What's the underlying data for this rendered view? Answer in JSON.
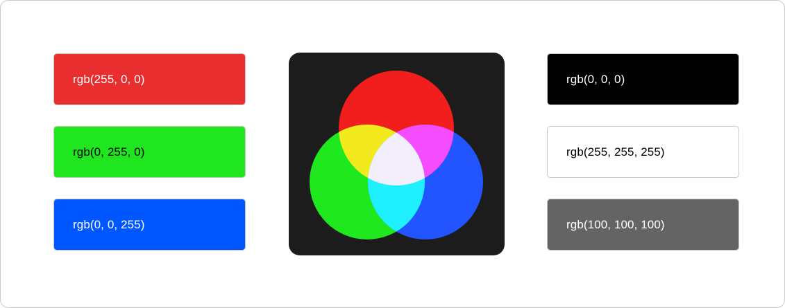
{
  "swatches": [
    {
      "id": "red",
      "label": "rgb(255, 0, 0)",
      "bg": "#e82e2e",
      "fg": "#ffffff"
    },
    {
      "id": "green",
      "label": "rgb(0, 255, 0)",
      "bg": "#20e620",
      "fg": "#000000"
    },
    {
      "id": "blue",
      "label": "rgb(0, 0, 255)",
      "bg": "#0057ff",
      "fg": "#ffffff"
    },
    {
      "id": "black",
      "label": "rgb(0, 0, 0)",
      "bg": "#000000",
      "fg": "#ffffff"
    },
    {
      "id": "white",
      "label": "rgb(255, 255, 255)",
      "bg": "#ffffff",
      "fg": "#000000"
    },
    {
      "id": "gray",
      "label": "rgb(100, 100, 100)",
      "bg": "#646464",
      "fg": "#ffffff"
    }
  ],
  "diagram": {
    "background": "#1c1c1c",
    "colors": {
      "red": "#f21d1d",
      "green": "#1fe81f",
      "blue": "#2255ff",
      "yellow": "#f3ea1e",
      "magenta": "#f54cff",
      "cyan": "#1ff0ff",
      "white": "#f2eefc"
    }
  }
}
